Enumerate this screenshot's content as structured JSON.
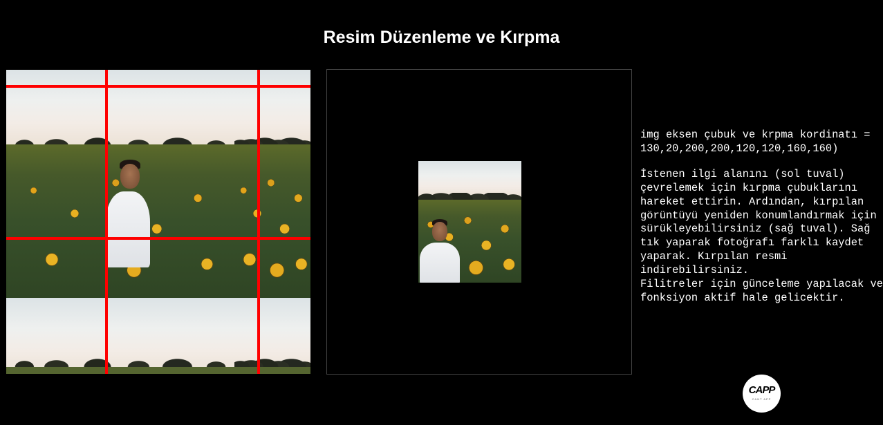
{
  "page": {
    "title": "Resim Düzenleme ve Kırpma"
  },
  "left_canvas": {
    "description_role": "source image with crop bars",
    "crop_bar_color": "#ff0000"
  },
  "right_canvas": {
    "role": "cropped image preview"
  },
  "info": {
    "coordinates": "img eksen çubuk ve krpma kordinatı = 130,20,200,200,120,120,160,160)",
    "instructions": "İstenen ilgi alanını (sol tuval) çevrelemek için kırpma çubuklarını hareket ettirin. Ardından, kırpılan görüntüyü yeniden konumlandırmak için sürükleyebilirsiniz (sağ tuval). Sağ tık yaparak fotoğrafı farklı kaydet yaparak. Kırpılan resmi indirebilirsiniz.",
    "filters_note": "Filitreler için günceleme yapılacak ve fonksiyon aktif hale gelicektir."
  },
  "logo": {
    "main_text": "CAPP",
    "sub_text": "CANT APP"
  },
  "colors": {
    "background": "#000000",
    "text": "#ffffff",
    "crop_bar": "#ff0000"
  }
}
